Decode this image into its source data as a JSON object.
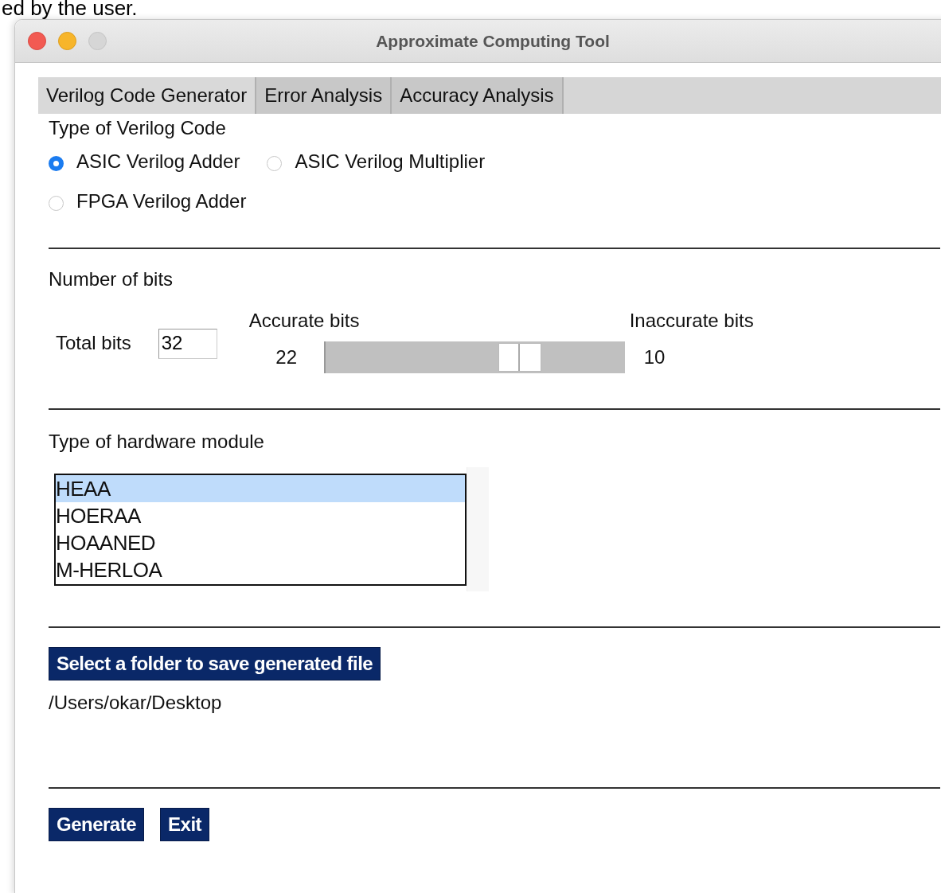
{
  "background_text": "ed by the user.",
  "window": {
    "title": "Approximate Computing Tool"
  },
  "tabs": [
    {
      "label": "Verilog Code Generator",
      "selected": true
    },
    {
      "label": "Error Analysis",
      "selected": false
    },
    {
      "label": "Accuracy Analysis",
      "selected": false
    }
  ],
  "code_type": {
    "heading": "Type of Verilog Code",
    "options": [
      {
        "label": "ASIC Verilog Adder",
        "selected": true
      },
      {
        "label": "ASIC Verilog Multiplier",
        "selected": false
      },
      {
        "label": "FPGA Verilog Adder",
        "selected": false
      }
    ]
  },
  "bits": {
    "heading": "Number of bits",
    "total_label": "Total bits",
    "total_value": "32",
    "accurate_label": "Accurate bits",
    "accurate_value": "22",
    "inaccurate_label": "Inaccurate bits",
    "inaccurate_value": "10",
    "slider": {
      "level": 0.65
    }
  },
  "hardware": {
    "heading": "Type of hardware module",
    "items": [
      {
        "label": "HEAA",
        "selected": true
      },
      {
        "label": "HOERAA",
        "selected": false
      },
      {
        "label": "HOAANED",
        "selected": false
      },
      {
        "label": "M-HERLOA",
        "selected": false
      }
    ]
  },
  "folder": {
    "button": "Select a folder to save generated file",
    "path": "/Users/okar/Desktop"
  },
  "buttons": [
    "Generate",
    "Exit"
  ]
}
